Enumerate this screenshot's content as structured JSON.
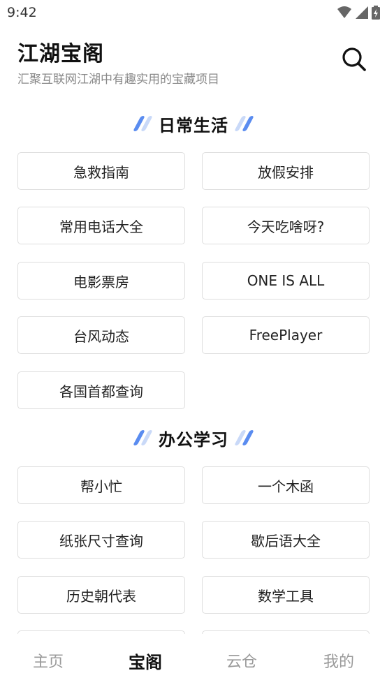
{
  "status_bar": {
    "time": "9:42",
    "icons": [
      "wifi-icon",
      "signal-icon",
      "battery-charging-icon"
    ]
  },
  "header": {
    "title": "江湖宝阁",
    "subtitle": "汇聚互联网江湖中有趣实用的宝藏项目",
    "search_icon": "search-icon"
  },
  "sections": [
    {
      "title": "日常生活",
      "items": [
        "急救指南",
        "放假安排",
        "常用电话大全",
        "今天吃啥呀?",
        "电影票房",
        "ONE  IS ALL",
        "台风动态",
        "FreePlayer",
        "各国首都查询"
      ]
    },
    {
      "title": "办公学习",
      "items": [
        "帮小忙",
        "一个木函",
        "纸张尺寸查询",
        "歇后语大全",
        "历史朝代表",
        "数学工具"
      ]
    }
  ],
  "bottom_nav": {
    "items": [
      "主页",
      "宝阁",
      "云仓",
      "我的"
    ],
    "active": "宝阁"
  },
  "colors": {
    "accent_dark": "#5a8cf0",
    "accent_light": "#c9d9f8",
    "border": "#dedede",
    "subtitle": "#888888"
  }
}
